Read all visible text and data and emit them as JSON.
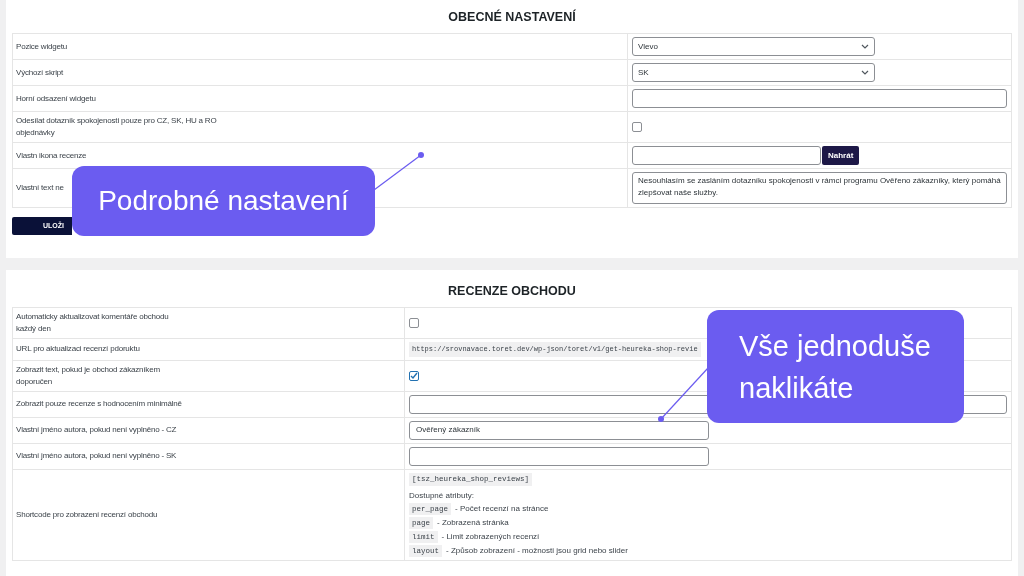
{
  "general": {
    "title": "OBECNÉ NASTAVENÍ",
    "rows": [
      {
        "label": "Pozice widgetu",
        "control": {
          "kind": "select",
          "value": "Vlevo"
        }
      },
      {
        "label": "Výchozí skript",
        "control": {
          "kind": "select",
          "value": "SK"
        }
      },
      {
        "label": "Horní odsazení widgetu",
        "control": {
          "kind": "wide_input"
        }
      },
      {
        "label": "Odesílat dotazník spokojenosti pouze pro CZ, SK, HU a RO objednávky",
        "control": {
          "kind": "checkbox",
          "checked": false
        }
      },
      {
        "label": "Vlastn ikona recenze",
        "control": {
          "kind": "file",
          "button": "Nahrát"
        }
      },
      {
        "label": "Vlastní text ne",
        "control": {
          "kind": "textarea",
          "value": "Nesouhlasím se zasláním dotazníku spokojenosti v rámci programu Ověřeno zákazníky, který pomáhá zlepšovat naše služby."
        }
      }
    ],
    "save_button": "ULOŽI"
  },
  "reviews": {
    "title": "RECENZE OBCHODU",
    "rows": [
      {
        "label": "Automaticky aktualizovat komentáře obchodu každý den",
        "control": {
          "kind": "checkbox",
          "checked": false
        }
      },
      {
        "label": "URL pro aktualizaci recenzí pdoruktu",
        "control": {
          "kind": "code",
          "value": "https://srovnavace.toret.dev/wp-json/toret/v1/get-heureka-shop-revie"
        }
      },
      {
        "label": "Zobrazit text, pokud je obchod zákazníkem doporučen",
        "control": {
          "kind": "checkbox",
          "checked": true
        }
      },
      {
        "label": "Zobrazit pouze recenze s hodnocením minimálně",
        "control": {
          "kind": "wide_input"
        }
      },
      {
        "label": "Vlastní jméno autora, pokud není vyplněno - CZ",
        "control": {
          "kind": "short_input",
          "value": "Ověřený zákazník"
        }
      },
      {
        "label": "Vlastní jméno autora, pokud není vyplněno - SK",
        "control": {
          "kind": "short_input"
        }
      },
      {
        "label": "Shortcode pro zobrazení recenzí obchodu",
        "control": {
          "kind": "shortcode",
          "value": "[tsz_heureka_shop_reviews]",
          "attributes_label": "Dostupné atributy:",
          "attributes": [
            {
              "code": "per_page",
              "description": "- Počet recenzí na stránce"
            },
            {
              "code": "page",
              "description": "- Zobrazená stránka"
            },
            {
              "code": "limit",
              "description": "- Limit zobrazených recenzí"
            },
            {
              "code": "layout",
              "description": "- Způsob zobrazení - možnosti jsou grid nebo slider"
            }
          ]
        }
      }
    ]
  },
  "callouts": [
    {
      "text": "Podrobné nastavení"
    },
    {
      "text": "Vše jednoduše naklikáte"
    }
  ]
}
